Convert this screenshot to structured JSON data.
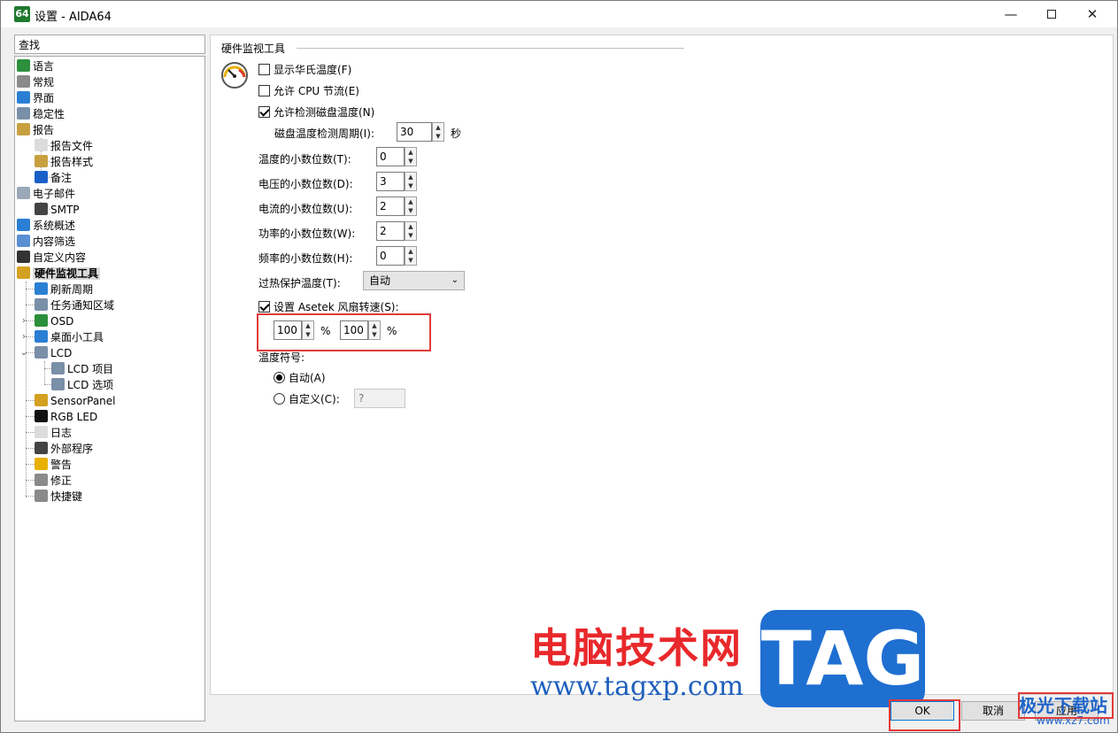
{
  "window": {
    "title": "设置 - AIDA64",
    "app_icon_text": "64"
  },
  "search": {
    "placeholder": "查找"
  },
  "tree": {
    "items": [
      {
        "label": "语言",
        "icon": "globe-icon",
        "color": "#2c8f3c"
      },
      {
        "label": "常规",
        "icon": "gear-icon",
        "color": "#8a8a8a"
      },
      {
        "label": "界面",
        "icon": "monitor-icon",
        "color": "#2a7fd4"
      },
      {
        "label": "稳定性",
        "icon": "gears-icon",
        "color": "#7a8fa8"
      },
      {
        "label": "报告",
        "icon": "report-icon",
        "color": "#c8a040"
      },
      {
        "label": "报告文件",
        "icon": "document-icon",
        "color": "#dcdcdc"
      },
      {
        "label": "报告样式",
        "icon": "style-icon",
        "color": "#c8a040"
      },
      {
        "label": "备注",
        "icon": "info-icon",
        "color": "#1a5fc8"
      },
      {
        "label": "电子邮件",
        "icon": "email-icon",
        "color": "#9aa8b8"
      },
      {
        "label": "SMTP",
        "icon": "phone-icon",
        "color": "#444444"
      },
      {
        "label": "系统概述",
        "icon": "monitor-icon",
        "color": "#2a7fd4"
      },
      {
        "label": "内容筛选",
        "icon": "filter-icon",
        "color": "#5a8fd4"
      },
      {
        "label": "自定义内容",
        "icon": "device-icon",
        "color": "#333333"
      },
      {
        "label": "硬件监视工具",
        "icon": "gauge-icon",
        "color": "#d4a020"
      },
      {
        "label": "刷新周期",
        "icon": "monitor-icon",
        "color": "#2a7fd4"
      },
      {
        "label": "任务通知区域",
        "icon": "taskbar-icon",
        "color": "#7a8fa8"
      },
      {
        "label": "OSD",
        "icon": "gauge-icon",
        "color": "#2c8f3c"
      },
      {
        "label": "桌面小工具",
        "icon": "gadget-icon",
        "color": "#2a7fd4"
      },
      {
        "label": "LCD",
        "icon": "lcd-icon",
        "color": "#7a8fa8"
      },
      {
        "label": "LCD 项目",
        "icon": "lcd-icon",
        "color": "#7a8fa8"
      },
      {
        "label": "LCD 选项",
        "icon": "lcd-icon",
        "color": "#7a8fa8"
      },
      {
        "label": "SensorPanel",
        "icon": "gauge-icon",
        "color": "#d4a020"
      },
      {
        "label": "RGB LED",
        "icon": "rgb-icon",
        "color": "#111111"
      },
      {
        "label": "日志",
        "icon": "document-icon",
        "color": "#dcdcdc"
      },
      {
        "label": "外部程序",
        "icon": "program-icon",
        "color": "#444444"
      },
      {
        "label": "警告",
        "icon": "warning-icon",
        "color": "#e8b000"
      },
      {
        "label": "修正",
        "icon": "wrench-icon",
        "color": "#8a8a8a"
      },
      {
        "label": "快捷键",
        "icon": "keyboard-icon",
        "color": "#8a8a8a"
      }
    ]
  },
  "panel": {
    "group_title": "硬件监视工具",
    "show_fahrenheit": {
      "label": "显示华氏温度(F)",
      "checked": false
    },
    "allow_cpu_throttle": {
      "label": "允许 CPU 节流(E)",
      "checked": false
    },
    "allow_disk_temp": {
      "label": "允许检测磁盘温度(N)",
      "checked": true
    },
    "disk_temp_period": {
      "label": "磁盘温度检测周期(I):",
      "value": "30",
      "unit": "秒"
    },
    "temp_decimals": {
      "label": "温度的小数位数(T):",
      "value": "0"
    },
    "voltage_decimals": {
      "label": "电压的小数位数(D):",
      "value": "3"
    },
    "current_decimals": {
      "label": "电流的小数位数(U):",
      "value": "2"
    },
    "power_decimals": {
      "label": "功率的小数位数(W):",
      "value": "2"
    },
    "freq_decimals": {
      "label": "频率的小数位数(H):",
      "value": "0"
    },
    "overheat": {
      "label": "过热保护温度(T):",
      "value": "自动"
    },
    "asetek": {
      "label": "设置 Asetek 风扇转速(S):",
      "checked": true,
      "value1": "100",
      "value2": "100",
      "unit": "%"
    },
    "temp_symbol": {
      "label": "温度符号:",
      "auto": "自动(A)",
      "custom": "自定义(C):",
      "custom_value": "?"
    }
  },
  "watermark": {
    "cn_text": "电脑技术网",
    "url": "www.tagxp.com",
    "tag": "TAG",
    "site": "极光下载站",
    "site_url": "www.xz7.com"
  },
  "buttons": {
    "ok": "OK",
    "cancel": "取消",
    "apply": "应用"
  }
}
